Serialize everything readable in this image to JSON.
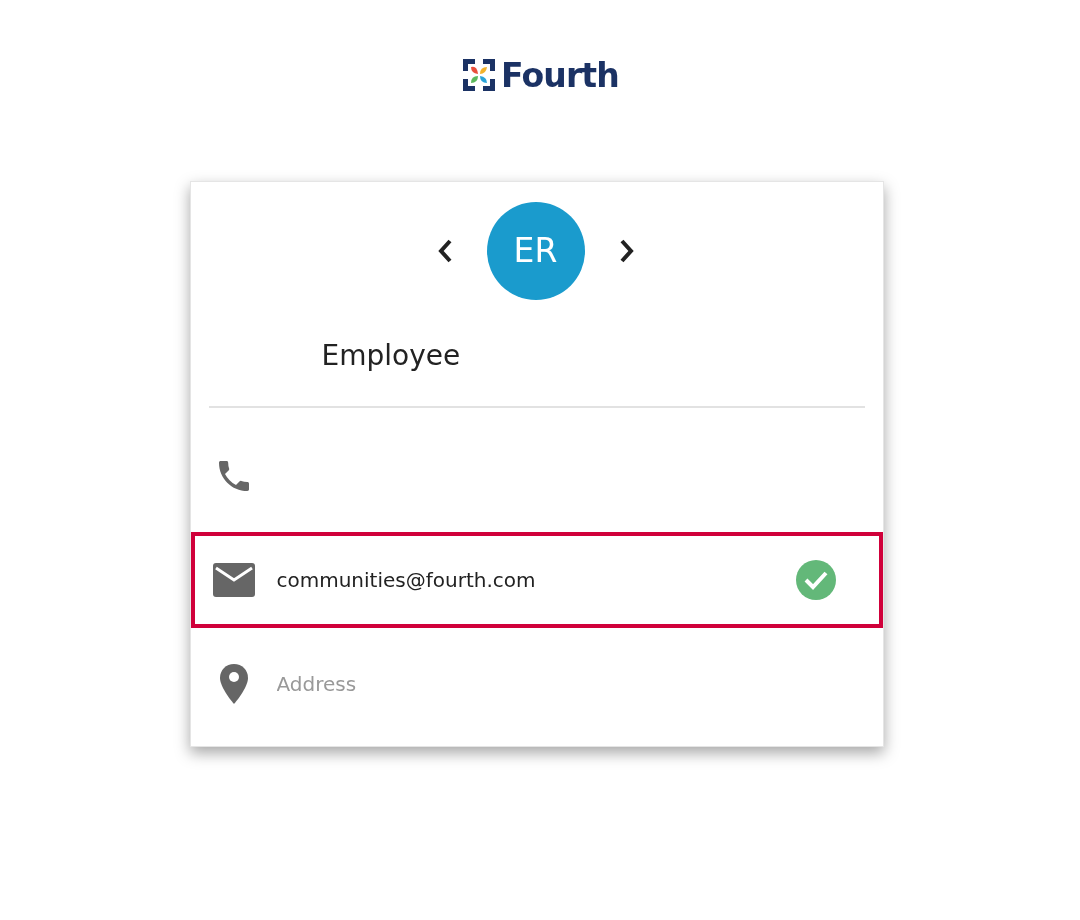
{
  "logo": {
    "text": "Fourth"
  },
  "profile": {
    "initials": "ER",
    "name": "Employee"
  },
  "fields": [
    {
      "kind": "phone",
      "highlighted": false
    },
    {
      "kind": "email",
      "value": "communities@fourth.com",
      "verified": true,
      "highlighted": true
    },
    {
      "kind": "address",
      "placeholder": "Address",
      "highlighted": false
    }
  ]
}
